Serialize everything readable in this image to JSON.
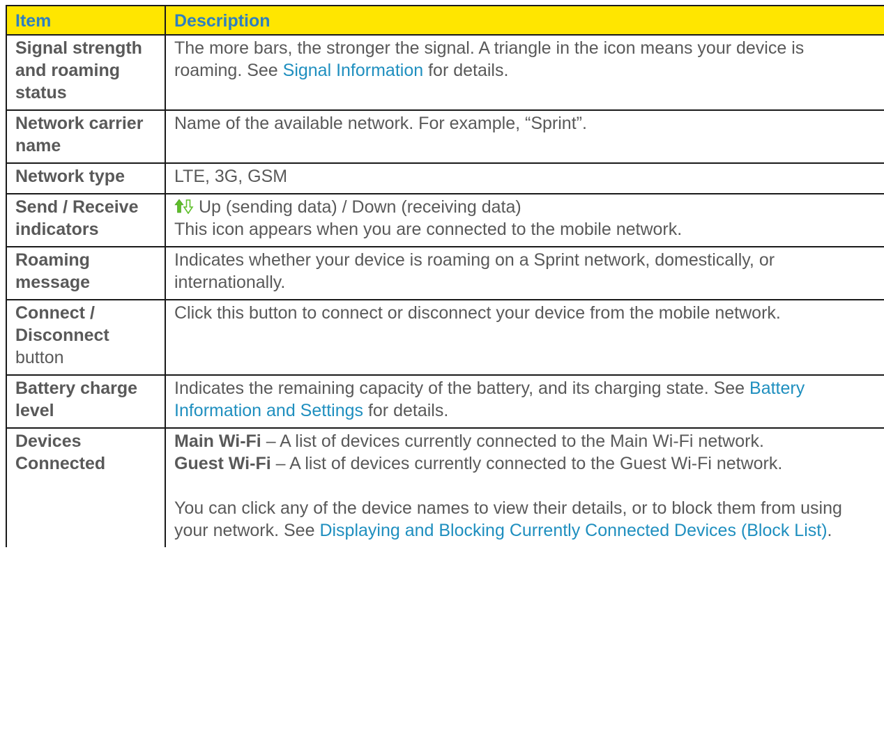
{
  "table": {
    "headers": {
      "item": "Item",
      "description": "Description"
    },
    "rows": [
      {
        "item": "Signal strength and roaming status",
        "desc_before": "The more bars, the stronger the signal. A triangle in the icon means your device is roaming. See ",
        "link": "Signal Information",
        "desc_after": " for details."
      },
      {
        "item": "Network carrier name",
        "desc": "Name of the available network. For example, “Sprint”."
      },
      {
        "item": "Network type",
        "desc": "LTE, 3G, GSM"
      },
      {
        "item": "Send / Receive indicators",
        "desc_line1": " Up (sending data) / Down (receiving data)",
        "desc_line2": "This icon appears when you are connected to the mobile network.",
        "icon": "up-down-arrows-icon",
        "icon_colors": {
          "up": "#5fbf2a",
          "down": "#5fbf2a"
        }
      },
      {
        "item": "Roaming message",
        "desc": "Indicates whether your device is roaming on a Sprint network, domestically, or internationally."
      },
      {
        "item_bold": "Connect / Disconnect",
        "item_plain": "button",
        "desc": "Click this button to connect or disconnect your device from the mobile network."
      },
      {
        "item": "Battery charge level",
        "desc_before": "Indicates the remaining capacity of the battery, and its charging state. See ",
        "link": "Battery Information and Settings",
        "desc_after": " for details."
      },
      {
        "item": "Devices Connected",
        "main_label": "Main Wi-Fi",
        "main_text": " – A list of devices currently connected to the Main Wi-Fi network.",
        "guest_label": "Guest Wi-Fi",
        "guest_text": " – A list of devices currently connected to the Guest Wi-Fi network.",
        "para_before": "You can click any of the device names to view their details, or to block them from using your network. See ",
        "link": "Displaying and Blocking Currently Connected Devices (Block List)",
        "para_after": "."
      }
    ]
  },
  "colors": {
    "header_bg": "#ffe600",
    "header_text": "#2f7fbf",
    "body_text": "#595959",
    "link": "#1f8fbf",
    "border": "#1a1a1a"
  }
}
